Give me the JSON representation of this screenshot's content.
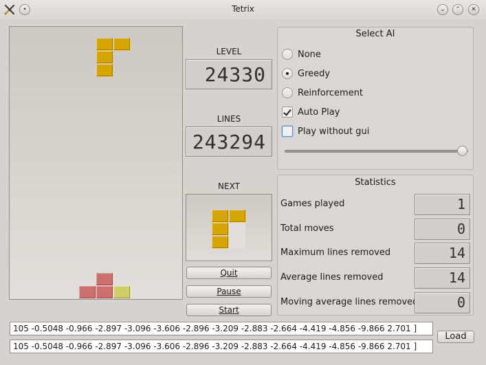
{
  "window": {
    "title": "Tetrix",
    "icons": [
      "app-logo-icon",
      "pin-icon",
      "minimize-icon",
      "maximize-icon",
      "close-icon"
    ]
  },
  "board": {
    "falling_piece": "L-piece",
    "stack": [
      "red",
      "red",
      "red",
      "lime"
    ]
  },
  "level": {
    "label": "LEVEL",
    "value": "24330"
  },
  "lines": {
    "label": "LINES",
    "value": "243294"
  },
  "next": {
    "label": "NEXT",
    "piece": "L-piece"
  },
  "buttons": {
    "quit": "Quit",
    "pause": "Pause",
    "start": "Start",
    "load": "Load"
  },
  "select_ai": {
    "title": "Select AI",
    "options": [
      {
        "label": "None",
        "selected": false
      },
      {
        "label": "Greedy",
        "selected": true
      },
      {
        "label": "Reinforcement",
        "selected": false
      }
    ],
    "auto_play": {
      "label": "Auto Play",
      "checked": true
    },
    "play_without_gui": {
      "label": "Play without gui",
      "checked": false
    },
    "speed_slider_fraction": 1.0
  },
  "statistics": {
    "title": "Statistics",
    "rows": [
      {
        "label": "Games played",
        "value": "1"
      },
      {
        "label": "Total moves",
        "value": "0"
      },
      {
        "label": "Maximum lines removed",
        "value": "14"
      },
      {
        "label": "Average lines removed",
        "value": "14"
      },
      {
        "label": "Moving average lines removed",
        "value": "0"
      }
    ]
  },
  "params": {
    "line1": "105 -0.5048 -0.966 -2.897 -3.096 -3.606 -2.896 -3.209 -2.883 -2.664 -4.419 -4.856 -9.866 2.701 ]",
    "line2": "105 -0.5048 -0.966 -2.897 -3.096 -3.606 -2.896 -3.209 -2.883 -2.664 -4.419 -4.856 -9.866 2.701 ]"
  },
  "colors": {
    "piece_yellow": "#d6a500",
    "piece_red": "#cc6f6d",
    "piece_lime": "#cfcf67",
    "focus_blue": "#5b8fd1"
  }
}
